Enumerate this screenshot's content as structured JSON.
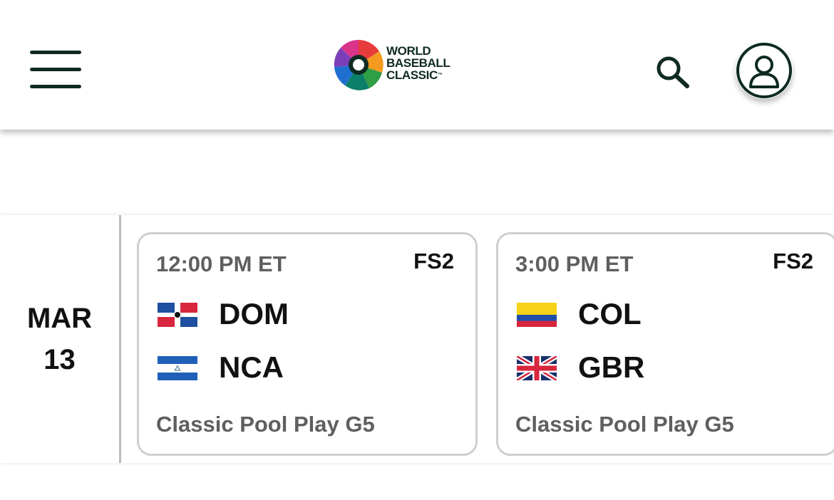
{
  "header": {
    "menu_icon": "hamburger-menu-icon",
    "logo": {
      "line1": "WORLD",
      "line2": "BASEBALL",
      "line3": "CLASSIC",
      "trademark": "™"
    },
    "search_icon": "search-icon",
    "account_icon": "user-account-icon"
  },
  "schedule": {
    "date": {
      "month": "MAR",
      "day": "13"
    },
    "games": [
      {
        "time": "12:00 PM ET",
        "network": "FS2",
        "away": {
          "abbr": "DOM",
          "flag": "dominican-republic-flag-icon"
        },
        "home": {
          "abbr": "NCA",
          "flag": "nicaragua-flag-icon"
        },
        "round": "Classic Pool Play G5"
      },
      {
        "time": "3:00 PM ET",
        "network": "FS2",
        "away": {
          "abbr": "COL",
          "flag": "colombia-flag-icon"
        },
        "home": {
          "abbr": "GBR",
          "flag": "great-britain-flag-icon"
        },
        "round": "Classic Pool Play G5"
      }
    ]
  },
  "colors": {
    "brand_dark": "#0e2a22",
    "muted_text": "#5f5f5f",
    "card_border": "#cfcfcf"
  }
}
